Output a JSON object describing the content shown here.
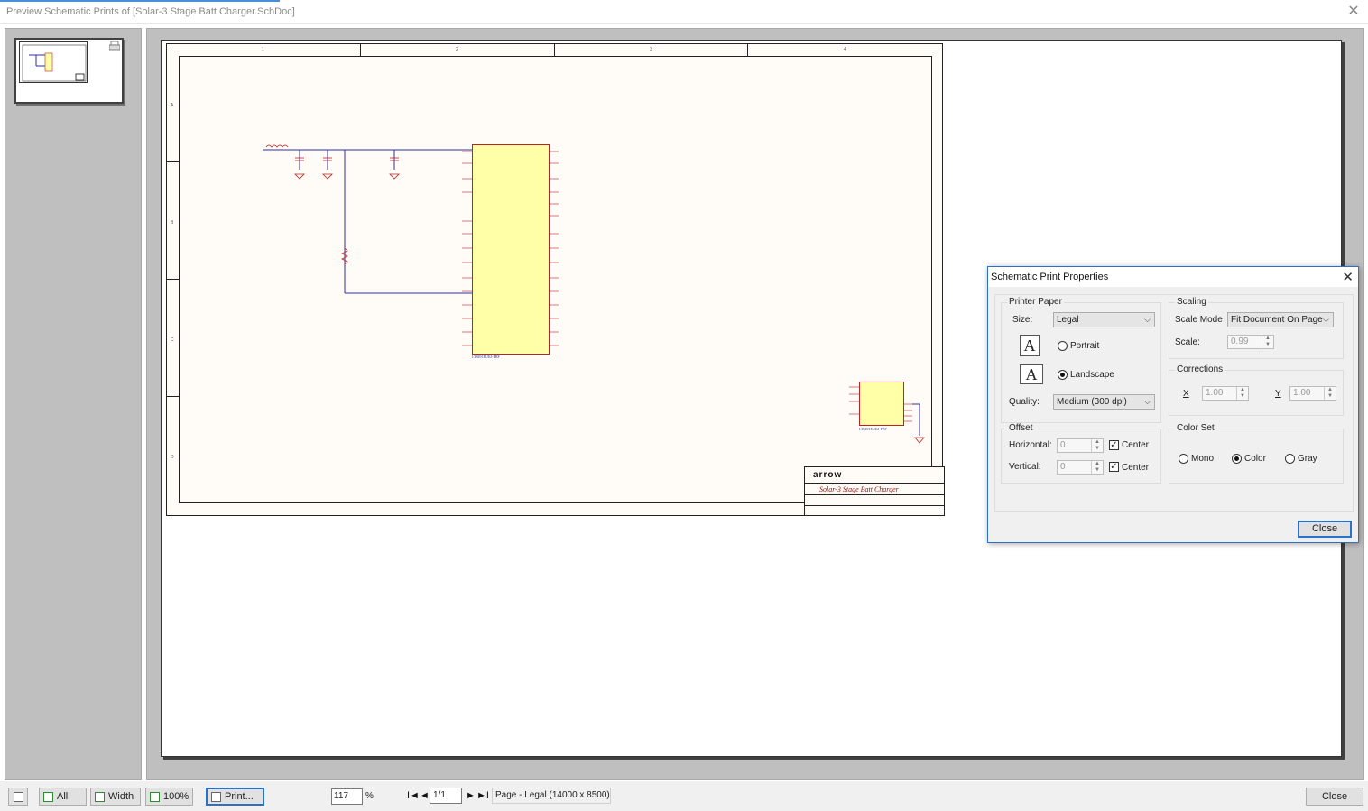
{
  "window": {
    "title": "Preview Schematic Prints of [Solar-3 Stage Batt Charger.SchDoc]",
    "close_glyph": "✕"
  },
  "schematic": {
    "title_block_logo": "arrow",
    "title_block_title": "Solar-3 Stage Batt Charger",
    "zone_numbers": [
      "1",
      "2",
      "3",
      "4"
    ],
    "zone_letters": [
      "A",
      "B",
      "C",
      "D"
    ],
    "ic1_name": "LT8491EUKJ-PBF",
    "ic2_name": "LT8491EUKJ-PBF"
  },
  "toolbar": {
    "all_label": "All",
    "width_label": "Width",
    "zoom100_label": "100%",
    "print_label": "Print...",
    "zoom_value": "117",
    "zoom_unit": "%",
    "page_value": "1/1",
    "page_info": "Page - Legal (14000 x 8500)",
    "close_label": "Close",
    "first_glyph": "I◄",
    "prev_glyph": "◄",
    "next_glyph": "►",
    "last_glyph": "►I"
  },
  "dialog": {
    "title": "Schematic Print Properties",
    "close_glyph": "✕",
    "printer_paper": {
      "group_label": "Printer Paper",
      "size_label": "Size:",
      "size_value": "Legal",
      "portrait_label": "Portrait",
      "landscape_label": "Landscape",
      "orientation": "Landscape",
      "quality_label": "Quality:",
      "quality_value": "Medium (300 dpi)",
      "icon_letter": "A"
    },
    "scaling": {
      "group_label": "Scaling",
      "mode_label": "Scale Mode",
      "mode_value": "Fit Document On Page",
      "scale_label": "Scale:",
      "scale_value": "0.99"
    },
    "corrections": {
      "group_label": "Corrections",
      "x_label": "X",
      "x_value": "1.00",
      "y_label": "Y",
      "y_value": "1.00"
    },
    "offset": {
      "group_label": "Offset",
      "horizontal_label": "Horizontal:",
      "horizontal_value": "0",
      "vertical_label": "Vertical:",
      "vertical_value": "0",
      "center_label": "Center",
      "horizontal_center_checked": true,
      "vertical_center_checked": true
    },
    "color_set": {
      "group_label": "Color Set",
      "mono_label": "Mono",
      "color_label": "Color",
      "gray_label": "Gray",
      "selected": "Color"
    },
    "close_label": "Close"
  },
  "colors": {
    "accent": "#2a72c9",
    "pane_bg": "#bfbfbf",
    "ic_fill": "#ffffa8",
    "wire": "#2e2ea0"
  }
}
